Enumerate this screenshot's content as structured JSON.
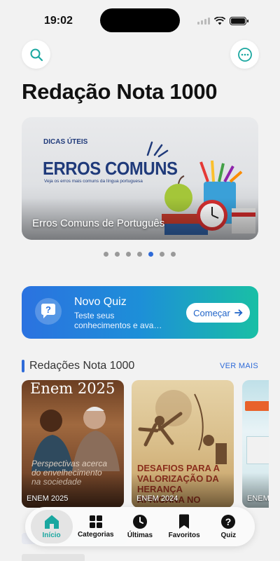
{
  "status_bar": {
    "time": "19:02"
  },
  "header": {
    "title": "Redação Nota 1000"
  },
  "hero": {
    "tag": "DICAS ÚTEIS",
    "headline": "ERROS COMUNS",
    "subtitle": "Veja os erros mais comuns da língua portuguesa",
    "caption": "Erros Comuns de Português",
    "page_count": 7,
    "active_page": 5
  },
  "quiz": {
    "title": "Novo Quiz",
    "subtitle": "Teste seus conhecimentos e ava…",
    "button_label": "Começar"
  },
  "section": {
    "title": "Redações Nota 1000",
    "see_more": "VER MAIS"
  },
  "cards": [
    {
      "year_title": "Enem 2025",
      "overlay": "Perspectivas acerca do envelhecimento na sociedade",
      "label": "ENEM 2025"
    },
    {
      "overlay": "DESAFIOS PARA A VALORIZAÇÃO DA HERANÇA AFRICANA NO BRASIL",
      "label": "ENEM 2024"
    },
    {
      "label": "ENEM"
    }
  ],
  "tabs": [
    {
      "label": "Início",
      "icon": "home-icon",
      "active": true
    },
    {
      "label": "Categorias",
      "icon": "grid-icon",
      "active": false
    },
    {
      "label": "Últimas",
      "icon": "clock-icon",
      "active": false
    },
    {
      "label": "Favoritos",
      "icon": "bookmark-icon",
      "active": false
    },
    {
      "label": "Quiz",
      "icon": "question-icon",
      "active": false
    }
  ],
  "colors": {
    "accent": "#2f6bd8",
    "teal": "#1aa7a0"
  }
}
